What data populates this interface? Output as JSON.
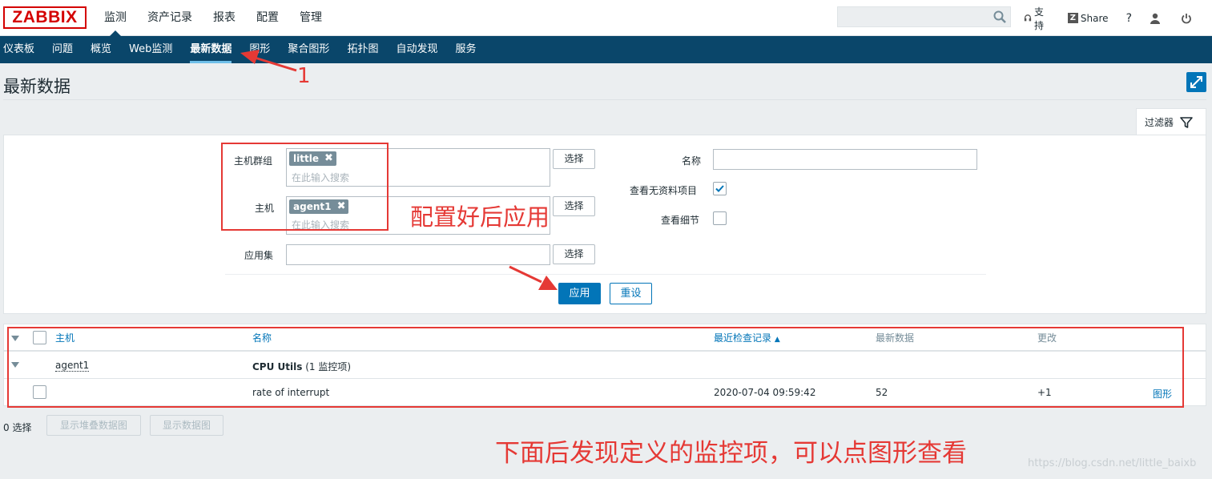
{
  "header": {
    "logo": "ZABBIX",
    "menu": [
      "监测",
      "资产记录",
      "报表",
      "配置",
      "管理"
    ],
    "links": {
      "support": "支持",
      "share": "Share",
      "help": "?"
    }
  },
  "submenu": [
    "仪表板",
    "问题",
    "概览",
    "Web监测",
    "最新数据",
    "图形",
    "聚合图形",
    "拓扑图",
    "自动发现",
    "服务"
  ],
  "page": {
    "title": "最新数据"
  },
  "filter": {
    "tab_label": "过滤器",
    "host_group_label": "主机群组",
    "host_group_tag": "little",
    "host_label": "主机",
    "host_tag": "agent1",
    "search_placeholder": "在此输入搜索",
    "app_label": "应用集",
    "select_button": "选择",
    "name_label": "名称",
    "show_without_data_label": "查看无资料项目",
    "show_without_data_checked": true,
    "show_details_label": "查看细节",
    "show_details_checked": false,
    "apply_button": "应用",
    "reset_button": "重设"
  },
  "table": {
    "columns": {
      "host": "主机",
      "name": "名称",
      "last_check": "最近检查记录",
      "last_value": "最新数据",
      "change": "更改"
    },
    "group_row": {
      "host": "agent1",
      "app": "CPU Utils",
      "count": "(1 监控项)"
    },
    "rows": [
      {
        "name": "rate of interrupt",
        "last_check": "2020-07-04 09:59:42",
        "last_value": "52",
        "change": "+1",
        "link": "图形"
      }
    ]
  },
  "footer": {
    "selected": "0 选择",
    "stacked_graph_button": "显示堆叠数据图",
    "graph_button": "显示数据图"
  },
  "annotations": {
    "step1": "1",
    "config_note": "配置好后应用",
    "bottom_note": "下面后发现定义的监控项，可以点图形查看",
    "watermark": "https://blog.csdn.net/little_baixb"
  },
  "colors": {
    "nav_bg": "#0a466a",
    "accent": "#0275b8",
    "annotation": "#e53935",
    "logo": "#d40000"
  }
}
